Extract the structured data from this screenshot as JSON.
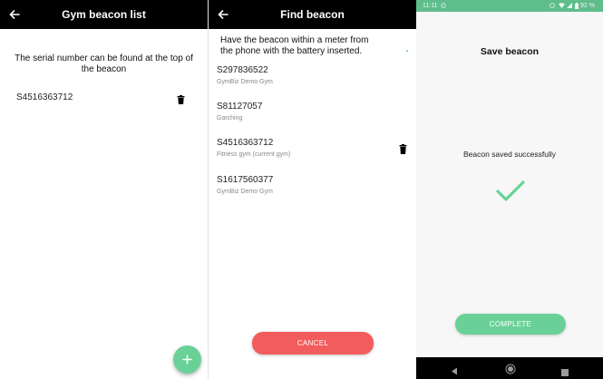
{
  "screen1": {
    "title": "Gym beacon list",
    "hint": "The serial number can be found at the top of the beacon",
    "beacons": [
      {
        "serial": "S4516363712"
      }
    ]
  },
  "screen2": {
    "title": "Find beacon",
    "hint": "Have the beacon within a meter from the phone with the battery inserted.",
    "beacons": [
      {
        "serial": "S297836522",
        "gym": "GymBiz Demo Gym"
      },
      {
        "serial": "S81127057",
        "gym": "Garching"
      },
      {
        "serial": "S4516363712",
        "gym": "Fitness gym (current gym)"
      },
      {
        "serial": "S1617560377",
        "gym": "GymBiz Demo Gym"
      }
    ],
    "cancel_label": "CANCEL"
  },
  "screen3": {
    "status": {
      "time": "11:11",
      "battery": "92 %"
    },
    "title": "Save beacon",
    "message": "Beacon saved successfully",
    "complete_label": "COMPLETE"
  },
  "colors": {
    "appbar": "#000000",
    "accent_green": "#69d197",
    "cancel_red": "#f25c5c",
    "status_green": "#5fbd8c"
  },
  "icons": {
    "back": "arrow-back-icon",
    "delete": "trash-icon",
    "add": "plus-icon",
    "success": "check-icon"
  }
}
